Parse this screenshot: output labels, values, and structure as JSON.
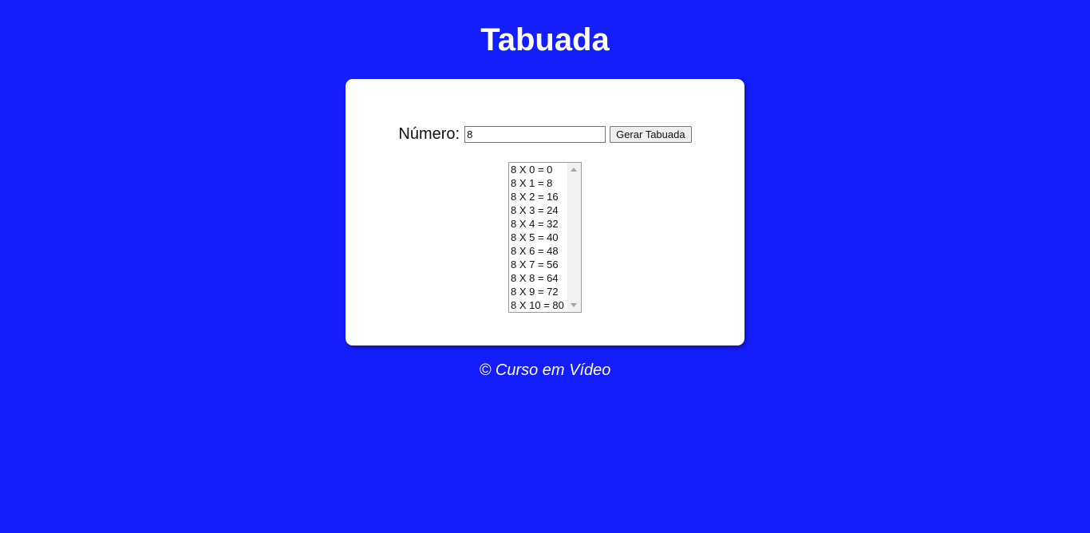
{
  "page": {
    "title": "Tabuada",
    "background_color": "#141dfc"
  },
  "form": {
    "number_label": "Número:",
    "number_value": "8",
    "generate_button_label": "Gerar Tabuada"
  },
  "table_list": {
    "items": [
      "8 X 0 = 0",
      "8 X 1 = 8",
      "8 X 2 = 16",
      "8 X 3 = 24",
      "8 X 4 = 32",
      "8 X 5 = 40",
      "8 X 6 = 48",
      "8 X 7 = 56",
      "8 X 8 = 64",
      "8 X 9 = 72",
      "8 X 10 = 80"
    ]
  },
  "footer": {
    "text": "© Curso em Vídeo"
  }
}
